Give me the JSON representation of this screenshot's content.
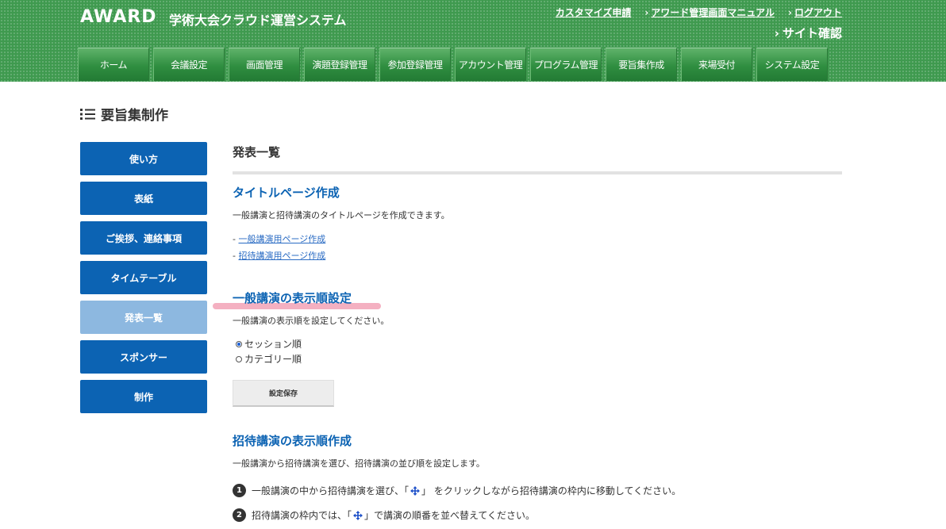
{
  "header": {
    "logo": "AWARD",
    "system_title": "学術大会クラウド運営システム",
    "util_links": [
      "カスタマイズ申請",
      "アワード管理画面マニュアル",
      "ログアウト"
    ],
    "site_confirm": "サイト確認",
    "nav": [
      "ホーム",
      "会議設定",
      "画面管理",
      "演題登録管理",
      "参加登録管理",
      "アカウント管理",
      "プログラム管理",
      "要旨集作成",
      "来場受付",
      "システム設定"
    ]
  },
  "page_title": "要旨集制作",
  "sidebar": {
    "items": [
      {
        "label": "使い方"
      },
      {
        "label": "表紙"
      },
      {
        "label": "ご挨拶、連絡事項"
      },
      {
        "label": "タイムテーブル"
      },
      {
        "label": "発表一覧"
      },
      {
        "label": "スポンサー"
      },
      {
        "label": "制作"
      }
    ],
    "active_index": 4
  },
  "main": {
    "heading": "発表一覧",
    "title_page": {
      "heading": "タイトルページ作成",
      "desc": "一般講演と招待講演のタイトルページを作成できます。",
      "links": [
        "一般講演用ページ作成",
        "招待講演用ページ作成"
      ]
    },
    "display_order": {
      "heading": "一般講演の表示順設定",
      "desc": "一般講演の表示順を設定してください。",
      "options": [
        "セッション順",
        "カテゴリー順"
      ],
      "selected": "セッション順",
      "save_label": "設定保存"
    },
    "invited": {
      "heading": "招待講演の表示順作成",
      "desc": "一般講演から招待講演を選び、招待講演の並び順を設定します。",
      "step1_a": "一般講演の中から招待講演を選び、「",
      "step1_b": "」 をクリックしながら招待講演の枠内に移動してください。",
      "step2_a": "招待講演の枠内では、「",
      "step2_b": "」で講演の順番を並べ替えてください。"
    }
  },
  "colors": {
    "header_green": "#3f9a4f",
    "sidebar_blue": "#0c63b3",
    "sidebar_active": "#8db8e0",
    "heading_blue": "#0c63b3",
    "highlight_pink": "#f2a2b6"
  }
}
